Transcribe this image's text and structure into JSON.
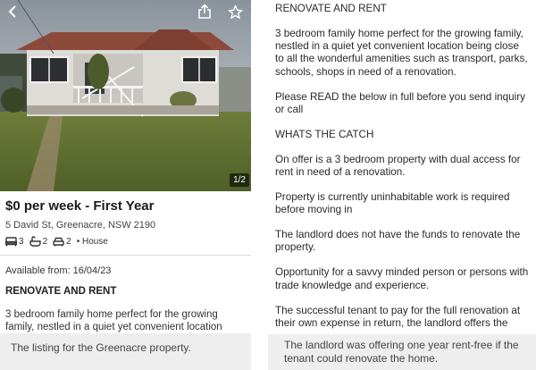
{
  "listing": {
    "image_counter": "1/2",
    "price": "$0 per week - First Year",
    "address": "5 David St, Greenacre, NSW 2190",
    "features": {
      "bedrooms": "3",
      "bathrooms": "2",
      "parking": "2",
      "type": "• House"
    },
    "available": "Available from: 16/04/23",
    "heading": "RENOVATE AND RENT",
    "body_preview": "3 bedroom family home perfect for the growing family, nestled in a quiet yet convenient location"
  },
  "description": {
    "paragraphs": [
      "RENOVATE AND RENT",
      "3 bedroom family home perfect for the growing family, nestled in a quiet yet convenient location being close to all the wonderful amenities such as transport, parks, schools, shops in need of a renovation.",
      "Please READ the below in full before you send inquiry or call",
      "WHATS THE CATCH",
      "On offer is a 3 bedroom property with dual access for rent in need of a renovation.",
      "Property is currently uninhabitable  work is required before moving in",
      "The landlord does not have the funds to renovate the property.",
      "Opportunity for a savvy minded person or persons with trade knowledge and experience.",
      "The successful tenant to pay for the full renovation at their own expense in return, the landlord offers the"
    ]
  },
  "captions": {
    "left": "The listing for the Greenacre property.",
    "right": "The landlord was offering one year rent-free if the tenant could renovate the home."
  },
  "icons": {
    "back": "chevron-left-icon",
    "share": "share-icon",
    "favourite": "star-icon",
    "bed": "bed-icon",
    "bath": "bath-icon",
    "car": "car-icon"
  }
}
